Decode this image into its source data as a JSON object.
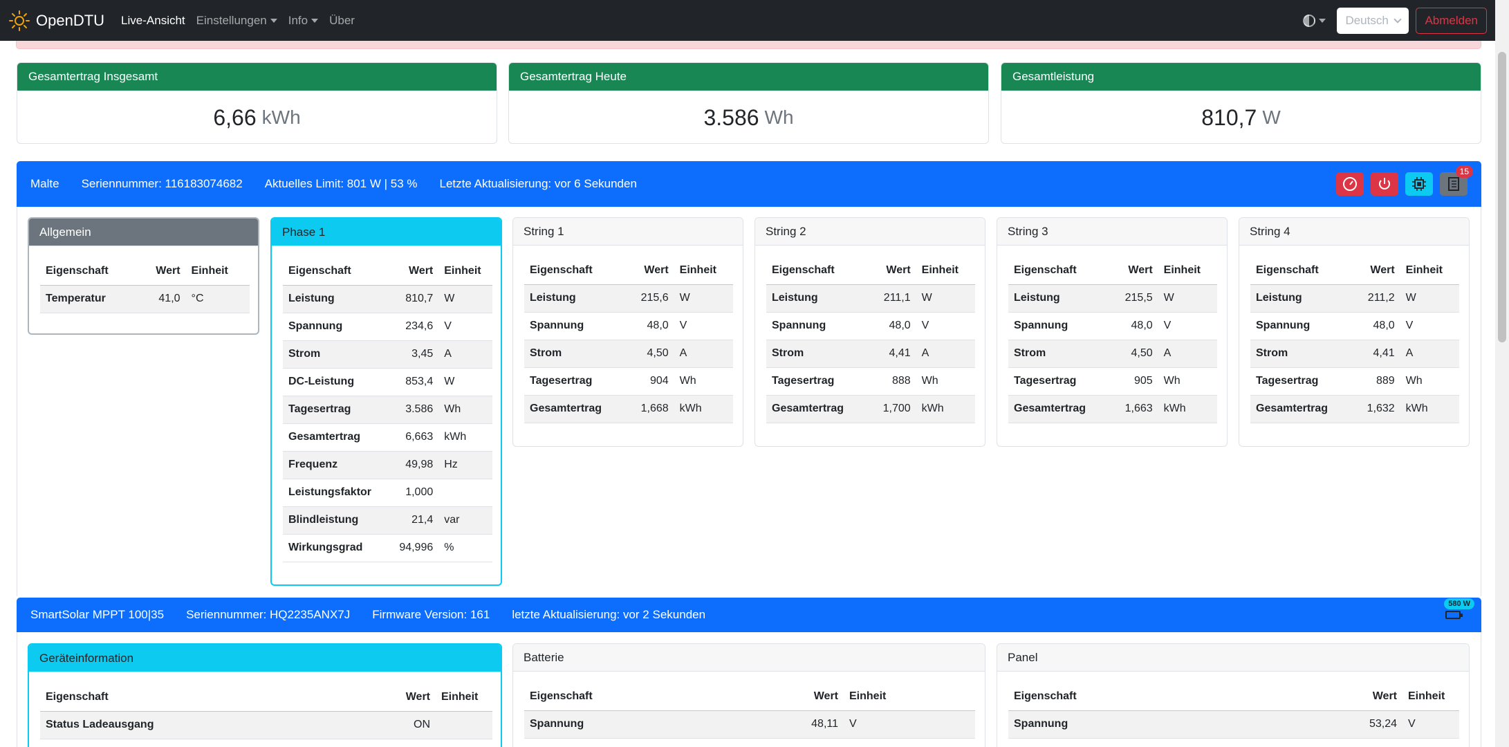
{
  "navbar": {
    "brand": "OpenDTU",
    "links": [
      {
        "label": "Live-Ansicht",
        "active": true,
        "dropdown": false
      },
      {
        "label": "Einstellungen",
        "active": false,
        "dropdown": true
      },
      {
        "label": "Info",
        "active": false,
        "dropdown": true
      },
      {
        "label": "Über",
        "active": false,
        "dropdown": false
      }
    ],
    "language": "Deutsch",
    "logout": "Abmelden"
  },
  "summary": [
    {
      "title": "Gesamtertrag Insgesamt",
      "value": "6,66",
      "unit": "kWh"
    },
    {
      "title": "Gesamtertrag Heute",
      "value": "3.586",
      "unit": "Wh"
    },
    {
      "title": "Gesamtleistung",
      "value": "810,7",
      "unit": "W"
    }
  ],
  "inverter": {
    "name": "Malte",
    "serial": "Seriennummer: 116183074682",
    "limit": "Aktuelles Limit: 801 W | 53 %",
    "updated": "Letzte Aktualisierung: vor 6 Sekunden",
    "event_count": "15",
    "headers": {
      "prop": "Eigenschaft",
      "val": "Wert",
      "unit": "Einheit"
    },
    "general": {
      "title": "Allgemein",
      "rows": [
        [
          "Temperatur",
          "41,0",
          "°C"
        ]
      ]
    },
    "phase": {
      "title": "Phase 1",
      "rows": [
        [
          "Leistung",
          "810,7",
          "W"
        ],
        [
          "Spannung",
          "234,6",
          "V"
        ],
        [
          "Strom",
          "3,45",
          "A"
        ],
        [
          "DC-Leistung",
          "853,4",
          "W"
        ],
        [
          "Tagesertrag",
          "3.586",
          "Wh"
        ],
        [
          "Gesamtertrag",
          "6,663",
          "kWh"
        ],
        [
          "Frequenz",
          "49,98",
          "Hz"
        ],
        [
          "Leistungsfaktor",
          "1,000",
          ""
        ],
        [
          "Blindleistung",
          "21,4",
          "var"
        ],
        [
          "Wirkungsgrad",
          "94,996",
          "%"
        ]
      ]
    },
    "strings": [
      {
        "title": "String 1",
        "rows": [
          [
            "Leistung",
            "215,6",
            "W"
          ],
          [
            "Spannung",
            "48,0",
            "V"
          ],
          [
            "Strom",
            "4,50",
            "A"
          ],
          [
            "Tagesertrag",
            "904",
            "Wh"
          ],
          [
            "Gesamtertrag",
            "1,668",
            "kWh"
          ]
        ]
      },
      {
        "title": "String 2",
        "rows": [
          [
            "Leistung",
            "211,1",
            "W"
          ],
          [
            "Spannung",
            "48,0",
            "V"
          ],
          [
            "Strom",
            "4,41",
            "A"
          ],
          [
            "Tagesertrag",
            "888",
            "Wh"
          ],
          [
            "Gesamtertrag",
            "1,700",
            "kWh"
          ]
        ]
      },
      {
        "title": "String 3",
        "rows": [
          [
            "Leistung",
            "215,5",
            "W"
          ],
          [
            "Spannung",
            "48,0",
            "V"
          ],
          [
            "Strom",
            "4,50",
            "A"
          ],
          [
            "Tagesertrag",
            "905",
            "Wh"
          ],
          [
            "Gesamtertrag",
            "1,663",
            "kWh"
          ]
        ]
      },
      {
        "title": "String 4",
        "rows": [
          [
            "Leistung",
            "211,2",
            "W"
          ],
          [
            "Spannung",
            "48,0",
            "V"
          ],
          [
            "Strom",
            "4,41",
            "A"
          ],
          [
            "Tagesertrag",
            "889",
            "Wh"
          ],
          [
            "Gesamtertrag",
            "1,632",
            "kWh"
          ]
        ]
      }
    ]
  },
  "mppt": {
    "name": "SmartSolar MPPT 100|35",
    "serial": "Seriennummer: HQ2235ANX7J",
    "firmware": "Firmware Version: 161",
    "updated": "letzte Aktualisierung: vor 2 Sekunden",
    "power_badge": "580 W",
    "cards": [
      {
        "title": "Geräteinformation",
        "rows": [
          [
            "Status Ladeausgang",
            "ON",
            ""
          ]
        ]
      },
      {
        "title": "Batterie",
        "rows": [
          [
            "Spannung",
            "48,11",
            "V"
          ]
        ]
      },
      {
        "title": "Panel",
        "rows": [
          [
            "Spannung",
            "53,24",
            "V"
          ]
        ]
      }
    ]
  },
  "colors": {
    "success": "#198754",
    "primary": "#0d6efd",
    "info": "#0dcaf0",
    "danger": "#dc3545",
    "secondary": "#6c757d"
  }
}
